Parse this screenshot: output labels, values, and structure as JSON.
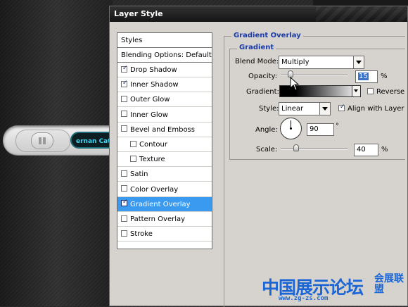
{
  "background": {
    "player": {
      "now_playing_text": "ernan Catt"
    }
  },
  "dialog": {
    "title": "Layer Style",
    "styles_panel": {
      "header": "Styles",
      "blending_options": "Blending Options: Default",
      "items": [
        {
          "label": "Drop Shadow",
          "checked": true,
          "indent": false,
          "selected": false
        },
        {
          "label": "Inner Shadow",
          "checked": true,
          "indent": false,
          "selected": false
        },
        {
          "label": "Outer Glow",
          "checked": false,
          "indent": false,
          "selected": false
        },
        {
          "label": "Inner Glow",
          "checked": false,
          "indent": false,
          "selected": false
        },
        {
          "label": "Bevel and Emboss",
          "checked": false,
          "indent": false,
          "selected": false
        },
        {
          "label": "Contour",
          "checked": false,
          "indent": true,
          "selected": false
        },
        {
          "label": "Texture",
          "checked": false,
          "indent": true,
          "selected": false
        },
        {
          "label": "Satin",
          "checked": false,
          "indent": false,
          "selected": false
        },
        {
          "label": "Color Overlay",
          "checked": false,
          "indent": false,
          "selected": false
        },
        {
          "label": "Gradient Overlay",
          "checked": true,
          "indent": false,
          "selected": true
        },
        {
          "label": "Pattern Overlay",
          "checked": false,
          "indent": false,
          "selected": false
        },
        {
          "label": "Stroke",
          "checked": false,
          "indent": false,
          "selected": false
        }
      ]
    },
    "gradient_overlay": {
      "section_title": "Gradient Overlay",
      "subsection_title": "Gradient",
      "blend_mode_label": "Blend Mode:",
      "blend_mode_value": "Multiply",
      "opacity_label": "Opacity:",
      "opacity_value": "15",
      "opacity_unit": "%",
      "opacity_level": 0.15,
      "gradient_label": "Gradient:",
      "reverse_label": "Reverse",
      "reverse_checked": false,
      "style_label": "Style:",
      "style_value": "Linear",
      "align_label": "Align with Layer",
      "align_checked": true,
      "angle_label": "Angle:",
      "angle_value": "90",
      "angle_unit": "°",
      "scale_label": "Scale:",
      "scale_value": "40",
      "scale_unit": "%",
      "scale_level": 0.4
    }
  },
  "watermark": {
    "main": "中国展示论坛",
    "sub": "会展联盟",
    "url": "www.zg-zs.com"
  },
  "colors": {
    "selection": "#3a9af0",
    "legend_text": "#1a3aa8",
    "lcd_text": "#3fd6f2",
    "watermark": "#1b66d6"
  }
}
